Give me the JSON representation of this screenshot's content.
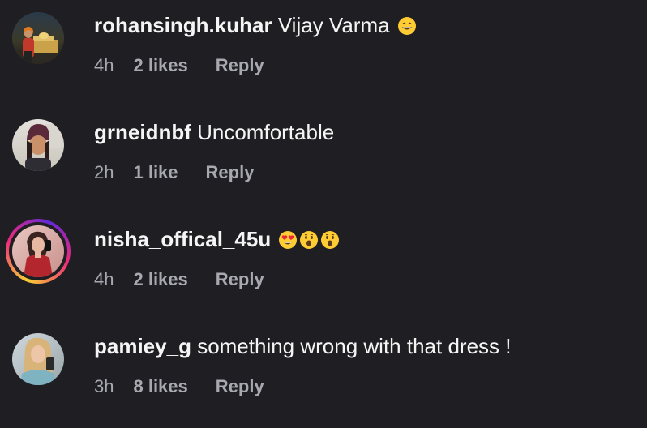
{
  "comments": [
    {
      "username": "rohansingh.kuhar",
      "text": "Vijay Varma",
      "emoji": [
        "grinning-face"
      ],
      "time": "4h",
      "likes": "2 likes",
      "reply": "Reply"
    },
    {
      "username": "grneidnbf",
      "text": "Uncomfortable",
      "emoji": [],
      "time": "2h",
      "likes": "1 like",
      "reply": "Reply"
    },
    {
      "username": "nisha_offical_45u",
      "text": "",
      "emoji": [
        "heart-eyes",
        "surprised-face",
        "surprised-face"
      ],
      "time": "4h",
      "likes": "2 likes",
      "reply": "Reply",
      "has_story_ring": true
    },
    {
      "username": "pamiey_g",
      "text": "something wrong with that dress !",
      "emoji": [],
      "time": "3h",
      "likes": "8 likes",
      "reply": "Reply"
    }
  ],
  "colors": {
    "background": "#1f1f23",
    "primary_text": "#f5f5f5",
    "secondary_text": "#a8a8b0",
    "story_ring_start": "#f9ce34",
    "story_ring_mid": "#ee2a7b",
    "story_ring_end": "#6228d7"
  }
}
